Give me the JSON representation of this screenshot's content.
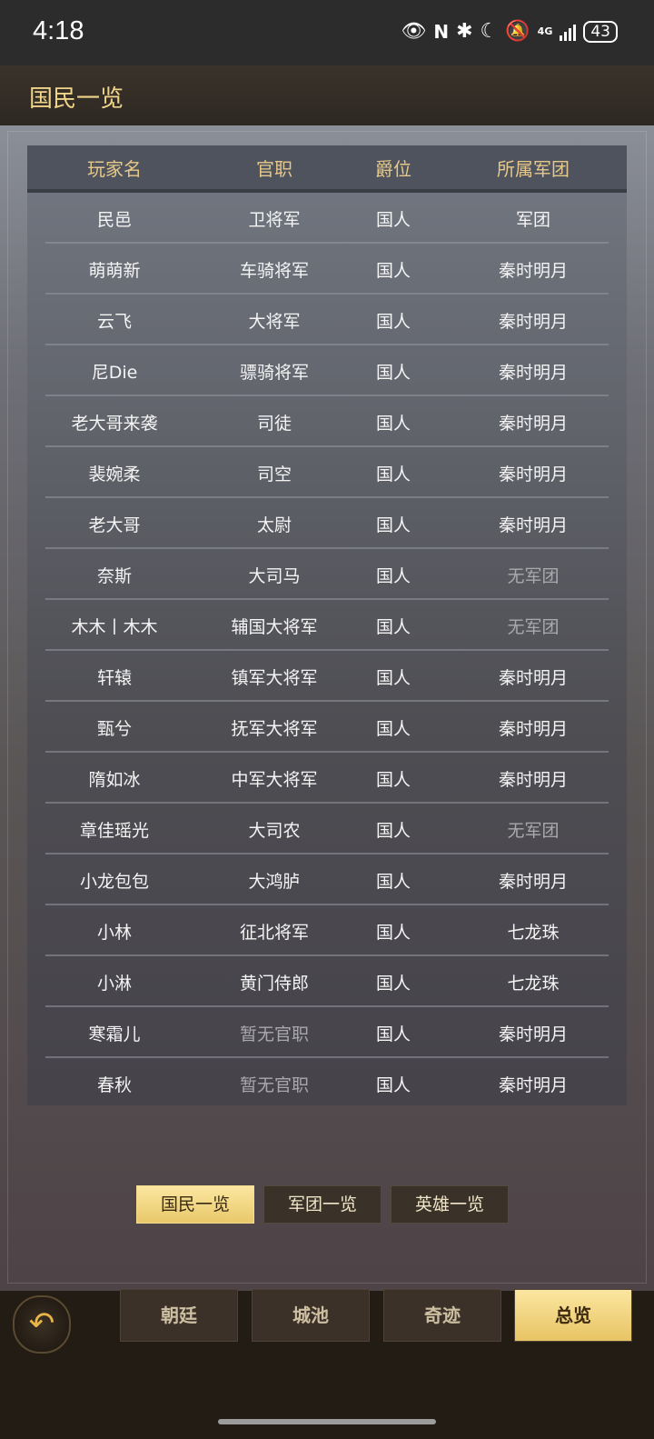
{
  "status": {
    "time": "4:18",
    "network": "4G",
    "battery": "43"
  },
  "header": {
    "title": "国民一览"
  },
  "table": {
    "headers": [
      "玩家名",
      "官职",
      "爵位",
      "所属军团"
    ],
    "rows": [
      [
        "民邑",
        "卫将军",
        "国人",
        "军团"
      ],
      [
        "萌萌新",
        "车骑将军",
        "国人",
        "秦时明月"
      ],
      [
        "云飞",
        "大将军",
        "国人",
        "秦时明月"
      ],
      [
        "尼Die",
        "骠骑将军",
        "国人",
        "秦时明月"
      ],
      [
        "老大哥来袭",
        "司徒",
        "国人",
        "秦时明月"
      ],
      [
        "裴婉柔",
        "司空",
        "国人",
        "秦时明月"
      ],
      [
        "老大哥",
        "太尉",
        "国人",
        "秦时明月"
      ],
      [
        "奈斯",
        "大司马",
        "国人",
        "无军团"
      ],
      [
        "木木丨木木",
        "辅国大将军",
        "国人",
        "无军团"
      ],
      [
        "轩辕",
        "镇军大将军",
        "国人",
        "秦时明月"
      ],
      [
        "甄兮",
        "抚军大将军",
        "国人",
        "秦时明月"
      ],
      [
        "隋如冰",
        "中军大将军",
        "国人",
        "秦时明月"
      ],
      [
        "章佳瑶光",
        "大司农",
        "国人",
        "无军团"
      ],
      [
        "小龙包包",
        "大鸿胪",
        "国人",
        "秦时明月"
      ],
      [
        "小林",
        "征北将军",
        "国人",
        "七龙珠"
      ],
      [
        "小淋",
        "黄门侍郎",
        "国人",
        "七龙珠"
      ],
      [
        "寒霜儿",
        "暂无官职",
        "国人",
        "秦时明月"
      ],
      [
        "春秋",
        "暂无官职",
        "国人",
        "秦时明月"
      ]
    ],
    "dim_values": [
      "无军团",
      "暂无官职"
    ]
  },
  "tabs": [
    {
      "label": "国民一览",
      "active": true
    },
    {
      "label": "军团一览",
      "active": false
    },
    {
      "label": "英雄一览",
      "active": false
    }
  ],
  "nav": [
    {
      "label": "朝廷",
      "active": false
    },
    {
      "label": "城池",
      "active": false
    },
    {
      "label": "奇迹",
      "active": false
    },
    {
      "label": "总览",
      "active": true
    }
  ],
  "colors": {
    "accent_gold": "#f0d48a",
    "active_tab": "#f4dc8e"
  }
}
